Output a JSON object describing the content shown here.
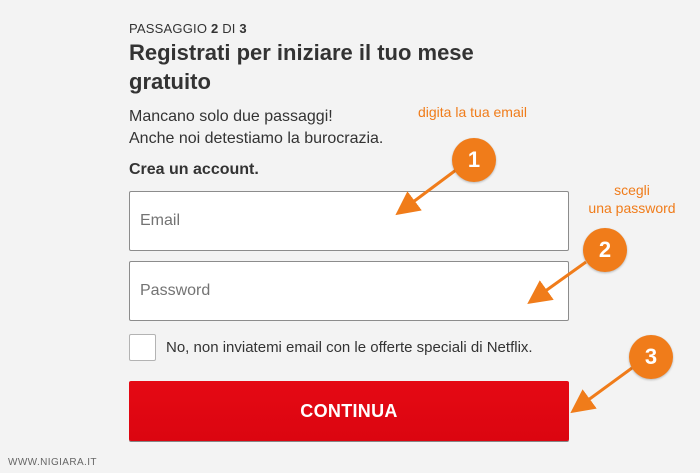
{
  "step": {
    "prefix": "PASSAGGIO",
    "current": "2",
    "of": "DI",
    "total": "3"
  },
  "title": "Registrati per iniziare il tuo mese gratuito",
  "subtitle": {
    "line1": "Mancano solo due passaggi!",
    "line2": "Anche noi detestiamo la burocrazia."
  },
  "create_account": "Crea un account.",
  "email": {
    "placeholder": "Email",
    "value": ""
  },
  "password": {
    "placeholder": "Password",
    "value": ""
  },
  "optout": {
    "checked": false,
    "label": "No, non inviatemi email con le offerte speciali di Netflix."
  },
  "continue_label": "CONTINUA",
  "watermark": "WWW.NIGIARA.IT",
  "annotations": {
    "email_hint": "digita la tua email",
    "password_hint_line1": "scegli",
    "password_hint_line2": "una password",
    "markers": [
      "1",
      "2",
      "3"
    ]
  },
  "colors": {
    "brand_red": "#e50914",
    "annotation_orange": "#f07c1a"
  }
}
